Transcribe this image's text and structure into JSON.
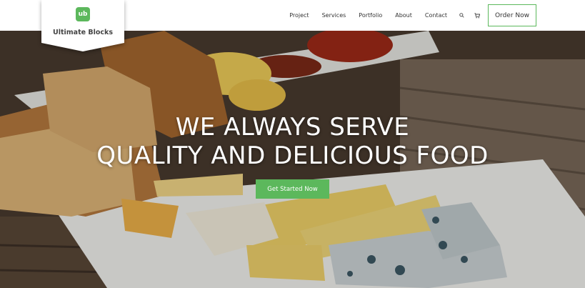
{
  "brand": {
    "mark": "ub",
    "name": "Ultimate Blocks",
    "accent": "#5cb85c"
  },
  "nav": {
    "items": [
      {
        "label": "Project"
      },
      {
        "label": "Services"
      },
      {
        "label": "Portfolio"
      },
      {
        "label": "About"
      },
      {
        "label": "Contact"
      }
    ],
    "search_icon": "search-icon",
    "cart_icon": "cart-icon",
    "order_label": "Order Now"
  },
  "hero": {
    "line1": "WE ALWAYS SERVE",
    "line2": "QUALITY AND DELICIOUS FOOD",
    "cta_label": "Get Started Now"
  }
}
